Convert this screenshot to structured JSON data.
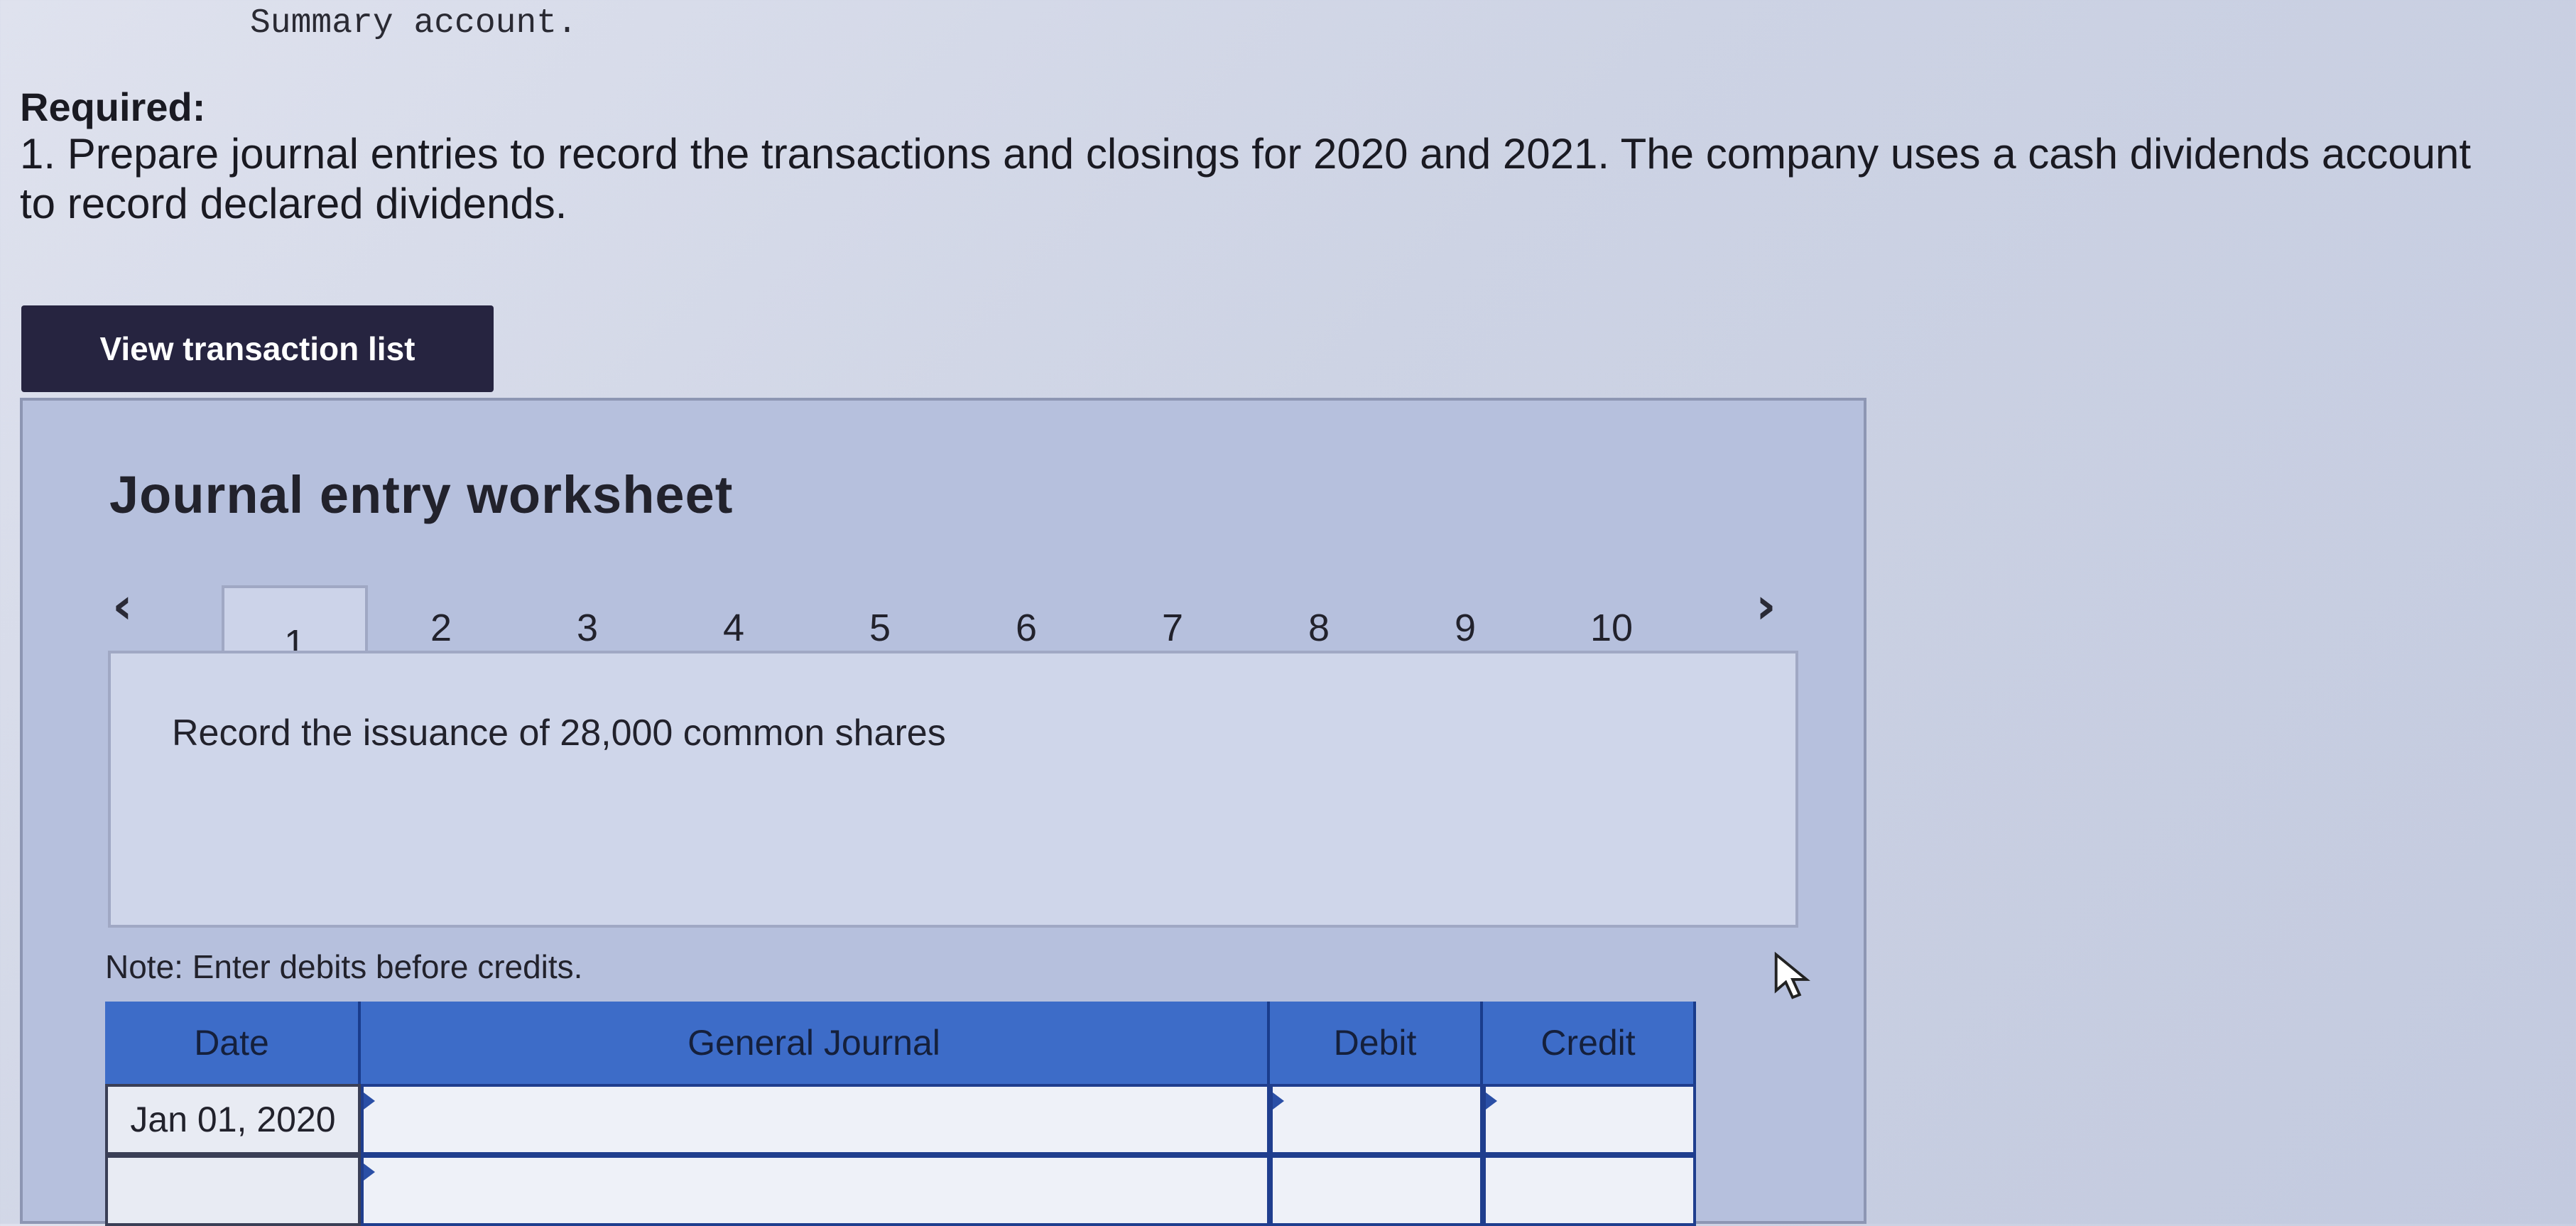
{
  "header": {
    "top_text": "Summary account.",
    "required_label": "Required:",
    "instruction": "1. Prepare journal entries to record the transactions and closings for 2020 and 2021. The company uses a cash dividends account to record declared dividends."
  },
  "buttons": {
    "view_transaction_list": "View transaction list"
  },
  "worksheet": {
    "title": "Journal entry worksheet",
    "tabs": [
      "1",
      "2",
      "3",
      "4",
      "5",
      "6",
      "7",
      "8",
      "9",
      "10"
    ],
    "active_tab": "1",
    "prev_icon": "chevron-left-icon",
    "next_icon": "chevron-right-icon",
    "description": "Record the issuance of 28,000 common shares",
    "note": "Note: Enter debits before credits."
  },
  "journal": {
    "columns": {
      "date": "Date",
      "general_journal": "General Journal",
      "debit": "Debit",
      "credit": "Credit"
    },
    "rows": [
      {
        "date": "Jan 01, 2020",
        "account": "",
        "debit": "",
        "credit": ""
      },
      {
        "date": "",
        "account": "",
        "debit": "",
        "credit": ""
      }
    ]
  },
  "colors": {
    "button_bg": "#262440",
    "header_blue": "#3d6cc8",
    "worksheet_bg": "#b6c0dd"
  }
}
